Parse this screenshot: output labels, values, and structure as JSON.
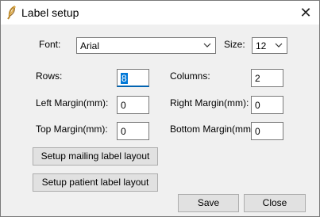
{
  "window": {
    "title": "Label setup",
    "icon": "feather-icon",
    "close_glyph": "✕"
  },
  "font": {
    "label": "Font:",
    "value": "Arial"
  },
  "size": {
    "label": "Size:",
    "value": "12"
  },
  "fields": {
    "rows": {
      "label": "Rows:",
      "value": "8"
    },
    "columns": {
      "label": "Columns:",
      "value": "2"
    },
    "left_margin": {
      "label": "Left Margin(mm):",
      "value": "0"
    },
    "right_margin": {
      "label": "Right Margin(mm):",
      "value": "0"
    },
    "top_margin": {
      "label": "Top Margin(mm):",
      "value": "0"
    },
    "bottom_margin": {
      "label": "Bottom Margin(mm):",
      "value": "0"
    }
  },
  "buttons": {
    "mailing_layout": "Setup mailing label layout",
    "patient_layout": "Setup patient label layout",
    "save": "Save",
    "close": "Close"
  },
  "colors": {
    "accent": "#0078d7",
    "background": "#f0f0f0"
  }
}
